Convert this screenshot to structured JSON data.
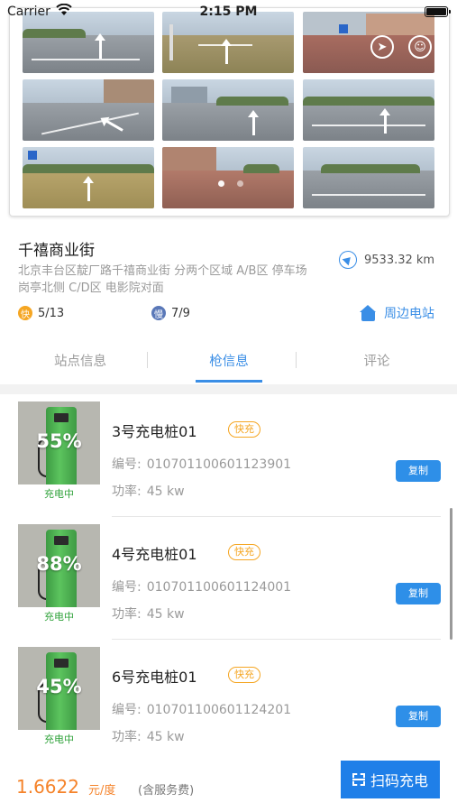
{
  "status_bar": {
    "carrier": "Carrier",
    "time": "2:15 PM"
  },
  "station": {
    "name": "千禧商业街",
    "distance": "9533.32 km",
    "address": "北京丰台区靛厂路千禧商业街 分两个区域 A/B区 停车场岗亭北侧  C/D区 电影院对面",
    "fast": {
      "badge": "快",
      "available": "5/13",
      "color": "#f5a623"
    },
    "slow": {
      "badge": "慢",
      "available": "7/9",
      "color": "#5a78b8"
    },
    "nearby_label": "周边电站"
  },
  "tabs": [
    {
      "label": "站点信息",
      "active": false
    },
    {
      "label": "枪信息",
      "active": true
    },
    {
      "label": "评论",
      "active": false
    }
  ],
  "chargers": [
    {
      "name": "3号充电桩01",
      "tag": "快充",
      "percent": "55%",
      "status": "充电中",
      "code_label": "编号:",
      "code": "010701100601123901",
      "power_label": "功率:",
      "power": "45 kw",
      "copy_label": "复制"
    },
    {
      "name": "4号充电桩01",
      "tag": "快充",
      "percent": "88%",
      "status": "充电中",
      "code_label": "编号:",
      "code": "010701100601124001",
      "power_label": "功率:",
      "power": "45 kw",
      "copy_label": "复制"
    },
    {
      "name": "6号充电桩01",
      "tag": "快充",
      "percent": "45%",
      "status": "充电中",
      "code_label": "编号:",
      "code": "010701100601124201",
      "power_label": "功率:",
      "power": "45 kw",
      "copy_label": "复制"
    }
  ],
  "bottom_bar": {
    "price": "1.6622",
    "unit": "元/度",
    "note": "(含服务费)",
    "scan_label": "扫码充电"
  },
  "colors": {
    "accent": "#3a8ee6",
    "price": "#f5832a",
    "tag": "#f5a623",
    "charging": "#2fa23a",
    "button": "#1f7fe8"
  }
}
